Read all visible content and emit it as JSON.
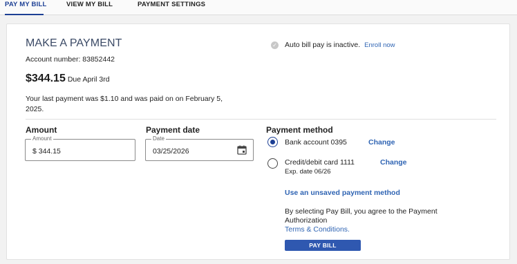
{
  "tabs": [
    {
      "label": "PAY MY BILL",
      "active": true
    },
    {
      "label": "VIEW MY BILL",
      "active": false
    },
    {
      "label": "PAYMENT SETTINGS",
      "active": false
    }
  ],
  "payment": {
    "title": "MAKE A PAYMENT",
    "account_number": "Account number: 83852442",
    "amount_due": "$344.15",
    "due_date": "Due April 3rd",
    "last_payment": "Your last payment was $1.10 and was paid on on February 5, 2025."
  },
  "autopay": {
    "status_text": "Auto bill pay is inactive.",
    "enroll_label": "Enroll now"
  },
  "amount": {
    "heading": "Amount",
    "field_label": "Amount",
    "value": "$ 344.15"
  },
  "payment_date": {
    "heading": "Payment date",
    "field_label": "Date",
    "value": "03/25/2026"
  },
  "payment_method": {
    "heading": "Payment method",
    "options": [
      {
        "label": "Bank account 0395",
        "change_label": "Change",
        "selected": true,
        "detail": ""
      },
      {
        "label": "Credit/debit card 1111",
        "change_label": "Change",
        "selected": false,
        "detail": "Exp. date 06/26"
      }
    ],
    "unsaved_label": "Use an unsaved payment method",
    "agreement_text": "By selecting Pay Bill, you agree to the Payment Authorization",
    "terms_label": "Terms & Conditions.",
    "pay_button_label": "PAY BILL"
  },
  "colors": {
    "accent": "#1c3f94",
    "link": "#2f64b3",
    "button": "#2f58b0"
  },
  "icons": {
    "autopay": "check-circle-icon",
    "date": "calendar-icon"
  }
}
